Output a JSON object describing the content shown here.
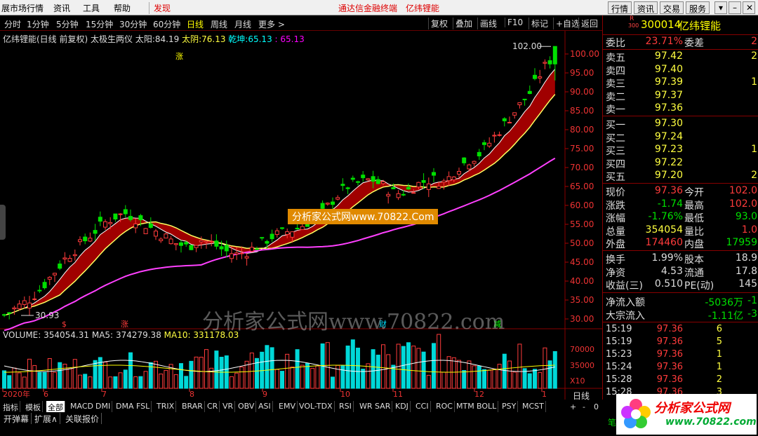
{
  "menubar": {
    "items": [
      "展市场行情",
      "资讯",
      "工具",
      "帮助",
      "发现"
    ],
    "title": "通达信金融终端",
    "stock_name": "亿纬锂能",
    "controls": [
      "行情",
      "资讯",
      "交易",
      "服务"
    ]
  },
  "periods": [
    "分时",
    "1分钟",
    "5分钟",
    "15分钟",
    "30分钟",
    "60分钟",
    "日线",
    "周线",
    "月线",
    "更多 >"
  ],
  "tools": [
    "复权",
    "叠加",
    "画线",
    "F10",
    "标记",
    "+自选",
    "返回"
  ],
  "indicator_line": {
    "name": "亿纬锂能(日线 前复权) 太极生两仪",
    "sun_label": "太阳:",
    "sun": "84.19",
    "moon_label": "太阴:",
    "moon": "76.13",
    "qk_label": "乾坤:",
    "qk": "65.13",
    "qk2": ": 65.13"
  },
  "volume_line": {
    "vol_label": "VOLUME:",
    "vol": "354054.31",
    "ma5_label": "MA5:",
    "ma5": "374279.38",
    "ma10_label": "MA10:",
    "ma10": "331178.03"
  },
  "chart_data": {
    "type": "candlestick",
    "price_ticks": [
      "100.00",
      "95.00",
      "90.00",
      "85.00",
      "80.00",
      "75.00",
      "70.00",
      "65.00",
      "60.00",
      "55.00",
      "50.00",
      "45.00",
      "40.00",
      "35.00",
      "30.00"
    ],
    "vol_ticks": [
      "70000",
      "35000",
      "X10"
    ],
    "max_label": "102.00",
    "min_label": "30.93",
    "month_labels": [
      "2020年",
      "6",
      "7",
      "8",
      "9",
      "10",
      "11",
      "12",
      "1"
    ],
    "markers": [
      {
        "text": "涨",
        "color": "#ffff00"
      },
      {
        "text": "$",
        "color": "#ff3b3b"
      },
      {
        "text": "涨",
        "color": "#ff3b3b"
      },
      {
        "text": "财",
        "color": "#00e0ff"
      },
      {
        "text": "减",
        "color": "#00ff00"
      }
    ],
    "watermark": "分析家公式网www.70822.com",
    "watermark2": "分析家公式网www.70822.Com"
  },
  "right": {
    "code": "300014",
    "name": "亿纬锂能",
    "r_label": "R",
    "r_num": "300",
    "wb_label": "委比",
    "wb": "23.71%",
    "wc_label": "委差",
    "wc": "2",
    "asks": [
      {
        "l": "卖五",
        "p": "97.42",
        "v": "2"
      },
      {
        "l": "卖四",
        "p": "97.40",
        "v": ""
      },
      {
        "l": "卖三",
        "p": "97.39",
        "v": "1"
      },
      {
        "l": "卖二",
        "p": "97.37",
        "v": ""
      },
      {
        "l": "卖一",
        "p": "97.36",
        "v": ""
      }
    ],
    "bids": [
      {
        "l": "买一",
        "p": "97.30",
        "v": ""
      },
      {
        "l": "买二",
        "p": "97.24",
        "v": ""
      },
      {
        "l": "买三",
        "p": "97.23",
        "v": "1"
      },
      {
        "l": "买四",
        "p": "97.22",
        "v": ""
      },
      {
        "l": "买五",
        "p": "97.20",
        "v": "2"
      }
    ],
    "q1": [
      {
        "l": "现价",
        "v": "97.36",
        "c": "red",
        "l2": "今开",
        "v2": "102.0",
        "c2": "red"
      },
      {
        "l": "涨跌",
        "v": "-1.74",
        "c": "grn",
        "l2": "最高",
        "v2": "102.0",
        "c2": "red"
      },
      {
        "l": "涨幅",
        "v": "-1.76%",
        "c": "grn",
        "l2": "最低",
        "v2": "93.0",
        "c2": "grn"
      },
      {
        "l": "总量",
        "v": "354054",
        "c": "yel",
        "l2": "量比",
        "v2": "1.0",
        "c2": "red"
      },
      {
        "l": "外盘",
        "v": "174460",
        "c": "red",
        "l2": "内盘",
        "v2": "17959",
        "c2": "grn"
      }
    ],
    "q2": [
      {
        "l": "换手",
        "v": "1.99%",
        "c": "wht",
        "l2": "股本",
        "v2": "18.9"
      },
      {
        "l": "净资",
        "v": "4.53",
        "c": "wht",
        "l2": "流通",
        "v2": "17.8"
      },
      {
        "l": "收益(三)",
        "v": "0.510",
        "c": "wht",
        "l2": "PE(动)",
        "v2": "145"
      }
    ],
    "flow": [
      {
        "l": "净流入额",
        "v": "-5036万",
        "v2": "-1"
      },
      {
        "l": "大宗流入",
        "v": "-1.11亿",
        "v2": "-3"
      }
    ],
    "ticks": [
      {
        "t": "15:19",
        "p": "97.36",
        "v": "6"
      },
      {
        "t": "15:19",
        "p": "97.36",
        "v": "5"
      },
      {
        "t": "15:23",
        "p": "97.36",
        "v": "1"
      },
      {
        "t": "15:24",
        "p": "97.36",
        "v": "1"
      },
      {
        "t": "15:28",
        "p": "97.36",
        "v": "2"
      },
      {
        "t": "15:28",
        "p": "97.36",
        "v": "3"
      }
    ],
    "footer": "笔"
  },
  "indicators": [
    "指标",
    "模板",
    "全部",
    "MACD",
    "DMI",
    "DMA",
    "FSL",
    "TRIX",
    "BRAR",
    "CR",
    "VR",
    "OBV",
    "ASI",
    "EMV",
    "VOL-TDX",
    "RSI",
    "WR",
    "SAR",
    "KDJ",
    "CCI",
    "ROC",
    "MTM",
    "BOLL",
    "PSY",
    "MCST"
  ],
  "bottom_tools": [
    "开弹幕",
    "扩展∧",
    "关联报价"
  ],
  "bottom_right": {
    "period": "日线",
    "plus": "+",
    "minus": "-",
    "zero": "0"
  },
  "logo": {
    "text": "分析家公式网",
    "url": "www.70822.com"
  }
}
